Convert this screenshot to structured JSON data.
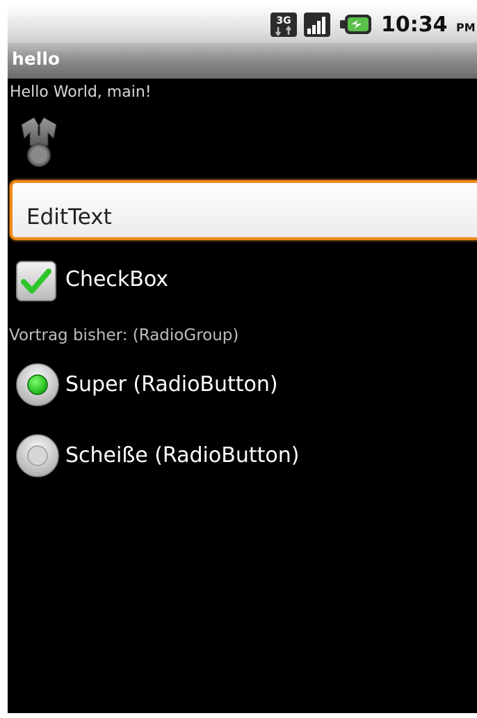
{
  "status_bar": {
    "network_icon": "3g-icon",
    "network_label": "3G",
    "signal_icon": "signal-bars-icon",
    "battery_icon": "battery-charging-icon",
    "time": "10:34",
    "ampm": "PM"
  },
  "title_bar": {
    "title": "hello"
  },
  "content": {
    "hello_text": "Hello World, main!",
    "image_icon": "android-robot-icon",
    "edit_text": {
      "value": "EditText"
    },
    "checkbox": {
      "label": "CheckBox",
      "checked": true,
      "check_color": "#2fc62b"
    },
    "radio_group": {
      "label": "Vortrag bisher: (RadioGroup)",
      "options": [
        {
          "label": "Super (RadioButton)",
          "selected": true
        },
        {
          "label": "Scheiße (RadioButton)",
          "selected": false
        }
      ],
      "selected_color": "#1ed61a"
    }
  },
  "colors": {
    "focus_border": "#f08a1c",
    "background": "#000000"
  }
}
